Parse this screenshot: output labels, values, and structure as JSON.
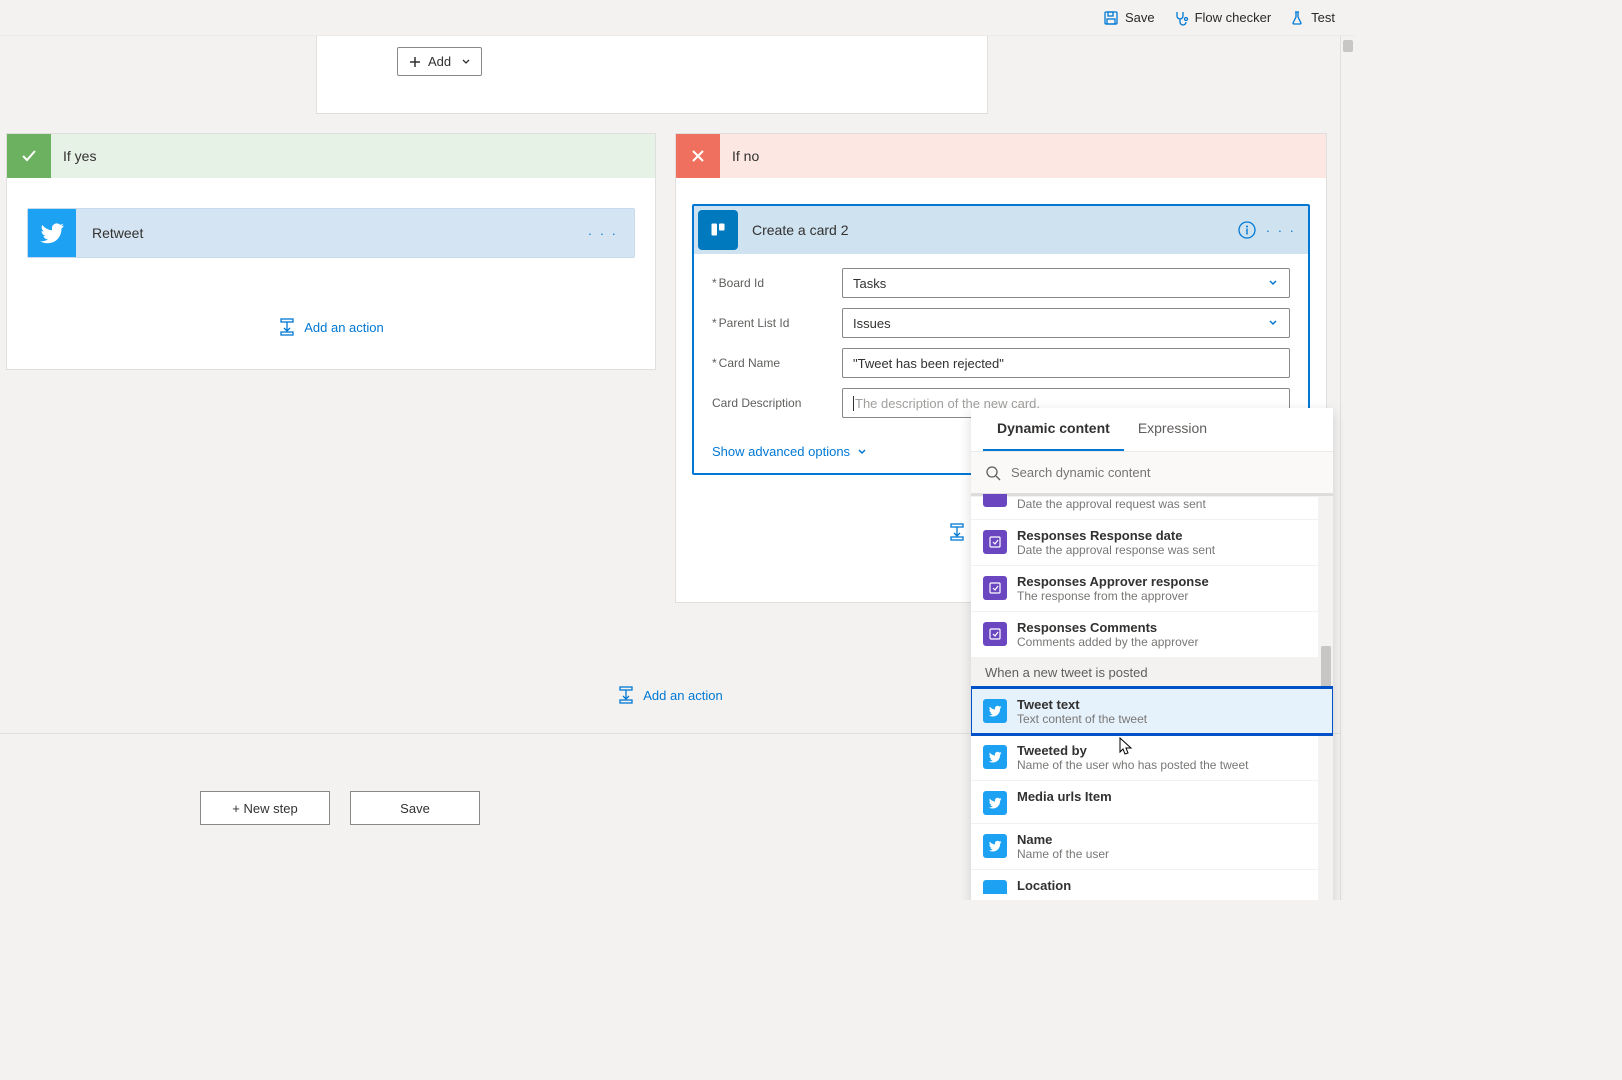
{
  "toolbar": {
    "save": "Save",
    "flow_checker": "Flow checker",
    "test": "Test"
  },
  "top_card": {
    "add_label": "Add"
  },
  "branch_yes": {
    "title": "If yes",
    "action_title": "Retweet",
    "add_action": "Add an action"
  },
  "branch_no": {
    "title": "If no",
    "action_title": "Create a card 2",
    "fields": {
      "board_id": {
        "label": "Board Id",
        "value": "Tasks"
      },
      "parent_list": {
        "label": "Parent List Id",
        "value": "Issues"
      },
      "card_name": {
        "label": "Card Name",
        "value": "\"Tweet has been rejected\""
      },
      "card_desc": {
        "label": "Card Description",
        "placeholder": "The description of the new card."
      }
    },
    "advanced": "Show advanced options",
    "add_action": "Add an action"
  },
  "bottom_add_action": "Add an action",
  "bottom_buttons": {
    "new_step": "+ New step",
    "save": "Save"
  },
  "dynamic": {
    "tab_dynamic": "Dynamic content",
    "tab_expression": "Expression",
    "search_placeholder": "Search dynamic content",
    "partial_desc": "Date the approval request was sent",
    "items_approval": [
      {
        "title": "Responses Response date",
        "desc": "Date the approval response was sent"
      },
      {
        "title": "Responses Approver response",
        "desc": "The response from the approver"
      },
      {
        "title": "Responses Comments",
        "desc": "Comments added by the approver"
      }
    ],
    "section_twitter": "When a new tweet is posted",
    "items_twitter": [
      {
        "title": "Tweet text",
        "desc": "Text content of the tweet",
        "highlighted": true
      },
      {
        "title": "Tweeted by",
        "desc": "Name of the user who has posted the tweet"
      },
      {
        "title": "Media urls Item",
        "desc": ""
      },
      {
        "title": "Name",
        "desc": "Name of the user"
      },
      {
        "title": "Location",
        "desc": ""
      }
    ]
  }
}
